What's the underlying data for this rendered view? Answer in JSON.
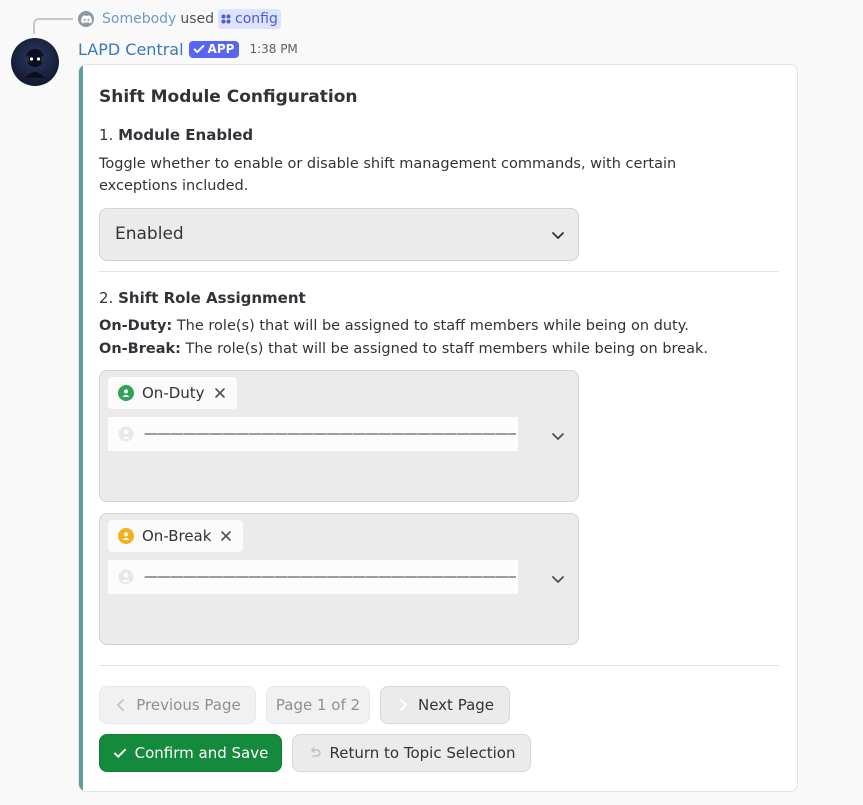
{
  "interaction": {
    "user": "Somebody",
    "used_text": "used",
    "command": "config"
  },
  "message": {
    "author": "LAPD Central",
    "badge": "APP",
    "timestamp": "1:38 PM"
  },
  "embed": {
    "title": "Shift Module Configuration",
    "accent_color": "#5f9c9c",
    "section1": {
      "number": "1.",
      "heading": "Module Enabled",
      "description": "Toggle whether to enable or disable shift management commands, with certain exceptions included.",
      "select_value": "Enabled"
    },
    "section2": {
      "number": "2.",
      "heading": "Shift Role Assignment",
      "onduty_label": "On-Duty:",
      "onduty_text": " The role(s) that will be assigned to staff members while being on duty.",
      "onbreak_label": "On-Break:",
      "onbreak_text": " The role(s) that will be assigned to staff members while being on break.",
      "onduty_chip": "On-Duty",
      "onduty_color": "#2fa35a",
      "onbreak_chip": "On-Break",
      "onbreak_color": "#f0b31c",
      "search_placeholder": "——————————————————————————————"
    },
    "pagination": {
      "previous": "Previous Page",
      "page_indicator": "Page 1 of 2",
      "next": "Next Page"
    },
    "actions": {
      "confirm": "Confirm and Save",
      "return": "Return to Topic Selection"
    }
  }
}
